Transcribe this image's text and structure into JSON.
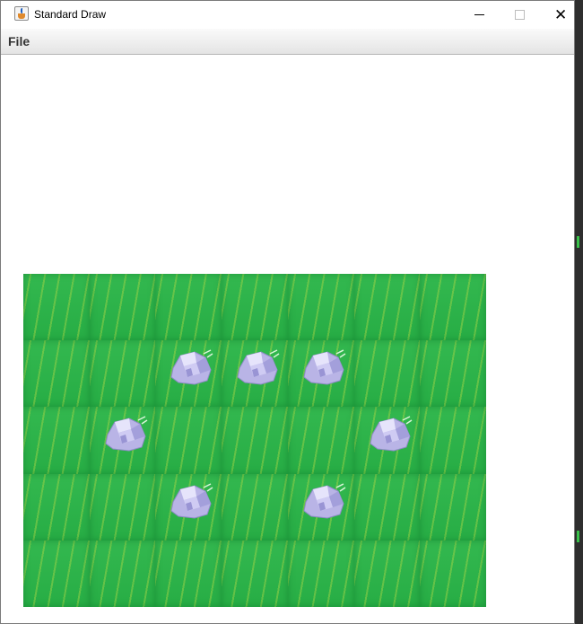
{
  "window": {
    "title": "Standard Draw",
    "controls": {
      "minimize": "minimize",
      "maximize": "maximize",
      "close": "close"
    }
  },
  "menubar": {
    "items": [
      {
        "label": "File"
      }
    ]
  },
  "board": {
    "rows": 5,
    "cols": 7,
    "tile": "grass",
    "rocks": [
      [
        2,
        1
      ],
      [
        3,
        1
      ],
      [
        4,
        1
      ],
      [
        1,
        2
      ],
      [
        5,
        2
      ],
      [
        2,
        3
      ],
      [
        4,
        3
      ]
    ]
  },
  "colors": {
    "grass": "#2db54a",
    "rock": "#b9b4e6"
  }
}
